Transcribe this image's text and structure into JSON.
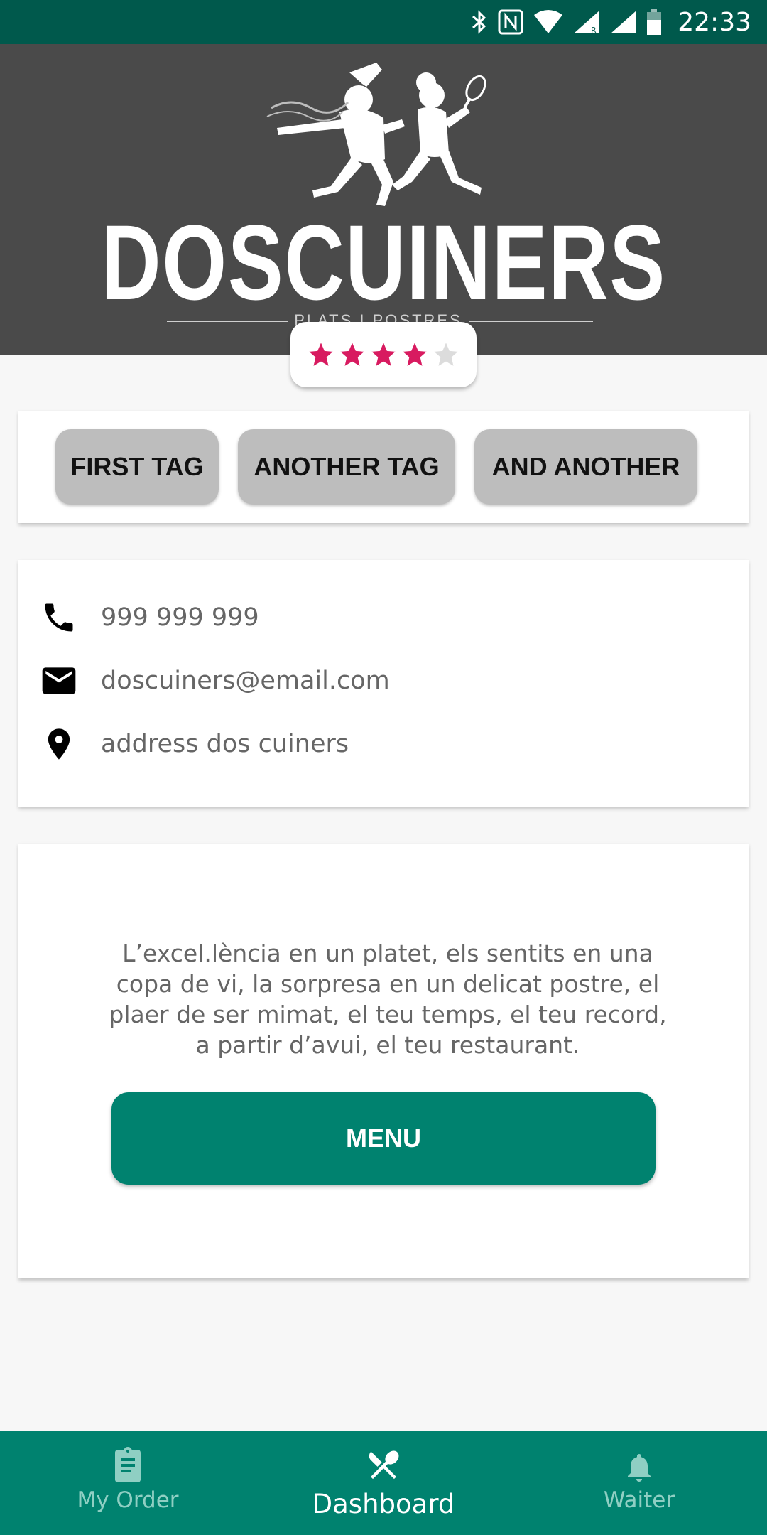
{
  "status_bar": {
    "time": "22:33",
    "icons": [
      "bluetooth-icon",
      "nfc-icon",
      "wifi-icon",
      "signal-roaming-icon",
      "signal-icon",
      "battery-icon"
    ]
  },
  "header": {
    "logo_name": "DOSCUINERS",
    "logo_subtitle": "PLATS I POSTRES"
  },
  "rating": {
    "value": 4,
    "max": 5,
    "filled_color": "#d81b60",
    "empty_color": "#dcdcdc"
  },
  "tags": [
    "FIRST TAG",
    "ANOTHER TAG",
    "AND ANOTHER"
  ],
  "contact": {
    "phone": "999 999 999",
    "email": "doscuiners@email.com",
    "address": "address dos cuiners",
    "icons": [
      "phone-icon",
      "email-icon",
      "location-pin-icon"
    ]
  },
  "about": {
    "description": "L’excel.lència en un platet, els sentits en una copa de vi, la sorpresa en un delicat postre, el plaer de ser mimat, el teu temps, el teu record, a partir d’avui, el teu restaurant.",
    "menu_button": "MENU"
  },
  "bottom_nav": {
    "items": [
      {
        "label": "My Order",
        "icon": "clipboard-icon",
        "active": false
      },
      {
        "label": "Dashboard",
        "icon": "fork-knife-icon",
        "active": true
      },
      {
        "label": "Waiter",
        "icon": "bell-icon",
        "active": false
      }
    ]
  },
  "colors": {
    "status_bar": "#00594c",
    "primary": "#00826f",
    "header_bg": "#4a4a4a",
    "tag_bg": "#bdbdbd"
  }
}
